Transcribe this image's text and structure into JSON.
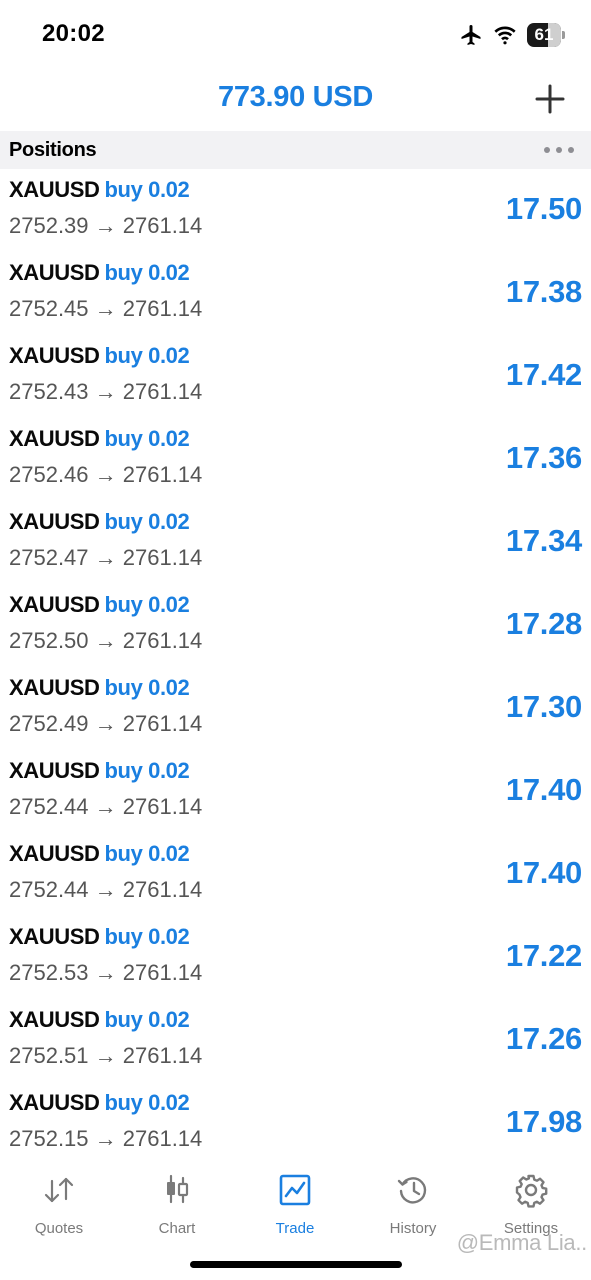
{
  "status_bar": {
    "time": "20:02",
    "battery_level": 61,
    "battery_text": "61",
    "icons": [
      "airplane-icon",
      "wifi-icon",
      "battery-icon"
    ]
  },
  "header": {
    "balance": "773.90 USD",
    "add_icon": "plus-icon"
  },
  "section": {
    "title": "Positions",
    "more_icon": "ellipsis-icon"
  },
  "positions": [
    {
      "symbol": "XAUUSD",
      "side": "buy 0.02",
      "prices": "2752.39 → 2761.14",
      "profit": "17.50"
    },
    {
      "symbol": "XAUUSD",
      "side": "buy 0.02",
      "prices": "2752.45 → 2761.14",
      "profit": "17.38"
    },
    {
      "symbol": "XAUUSD",
      "side": "buy 0.02",
      "prices": "2752.43 → 2761.14",
      "profit": "17.42"
    },
    {
      "symbol": "XAUUSD",
      "side": "buy 0.02",
      "prices": "2752.46 → 2761.14",
      "profit": "17.36"
    },
    {
      "symbol": "XAUUSD",
      "side": "buy 0.02",
      "prices": "2752.47 → 2761.14",
      "profit": "17.34"
    },
    {
      "symbol": "XAUUSD",
      "side": "buy 0.02",
      "prices": "2752.50 → 2761.14",
      "profit": "17.28"
    },
    {
      "symbol": "XAUUSD",
      "side": "buy 0.02",
      "prices": "2752.49 → 2761.14",
      "profit": "17.30"
    },
    {
      "symbol": "XAUUSD",
      "side": "buy 0.02",
      "prices": "2752.44 → 2761.14",
      "profit": "17.40"
    },
    {
      "symbol": "XAUUSD",
      "side": "buy 0.02",
      "prices": "2752.44 → 2761.14",
      "profit": "17.40"
    },
    {
      "symbol": "XAUUSD",
      "side": "buy 0.02",
      "prices": "2752.53 → 2761.14",
      "profit": "17.22"
    },
    {
      "symbol": "XAUUSD",
      "side": "buy 0.02",
      "prices": "2752.51 → 2761.14",
      "profit": "17.26"
    },
    {
      "symbol": "XAUUSD",
      "side": "buy 0.02",
      "prices": "2752.15 → 2761.14",
      "profit": "17.98"
    }
  ],
  "tabs": [
    {
      "label": "Quotes",
      "icon": "up-down-arrows-icon",
      "active": false
    },
    {
      "label": "Chart",
      "icon": "candlestick-icon",
      "active": false
    },
    {
      "label": "Trade",
      "icon": "trend-line-icon",
      "active": true
    },
    {
      "label": "History",
      "icon": "clock-history-icon",
      "active": false
    },
    {
      "label": "Settings",
      "icon": "gear-icon",
      "active": false
    }
  ],
  "watermark": "@Emma Lia..",
  "colors": {
    "accent": "#1a7fe0",
    "secondary_text": "#555555",
    "tab_inactive": "#7a7a7a",
    "section_background": "#f2f2f4"
  }
}
